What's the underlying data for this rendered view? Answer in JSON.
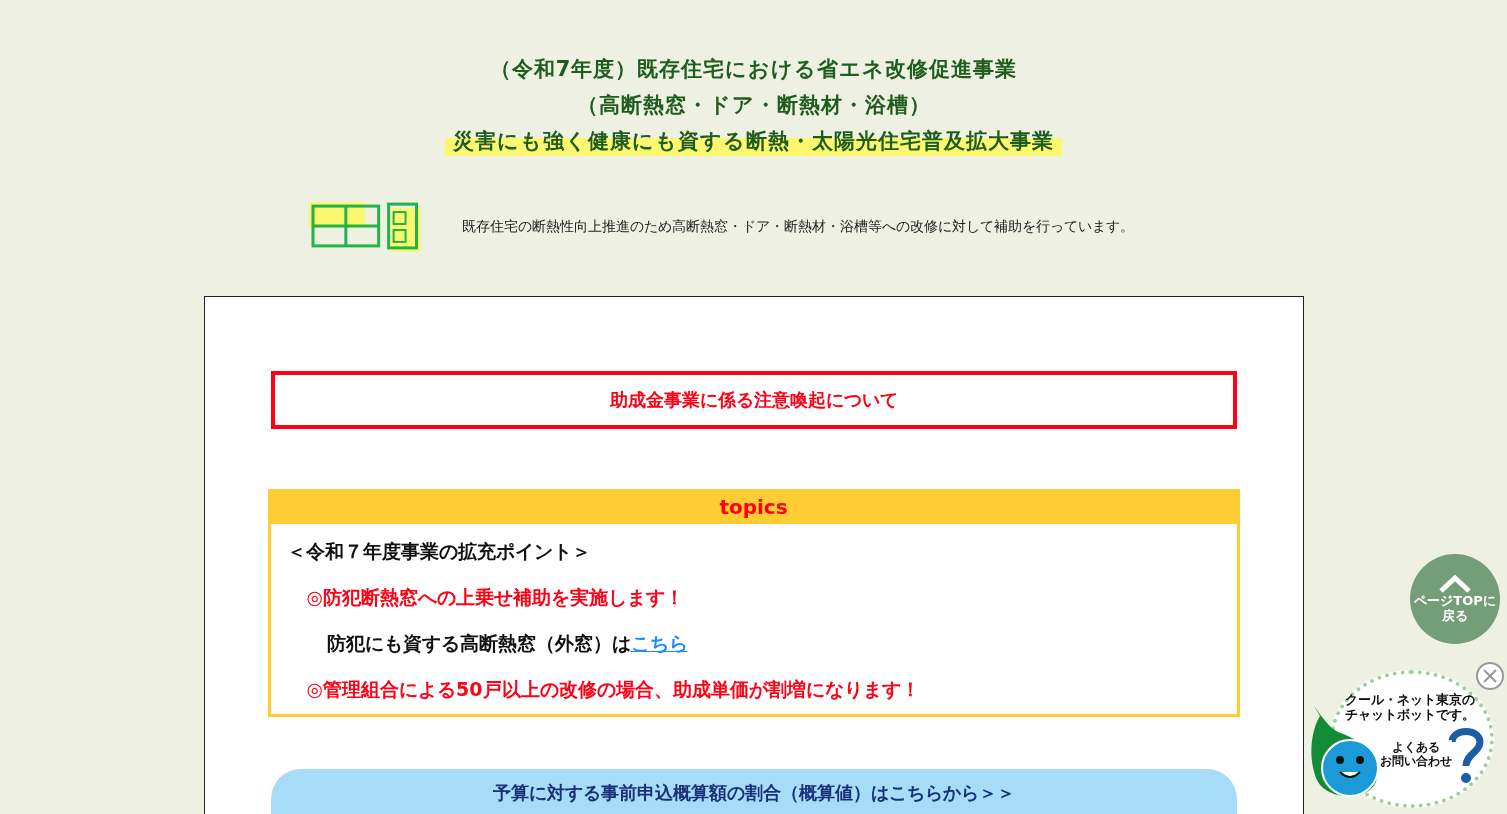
{
  "header": {
    "title_lines": [
      "（令和7年度）既存住宅における省エネ改修促進事業",
      "（高断熱窓・ドア・断熱材・浴槽）"
    ],
    "highlight_line": "災害にも強く健康にも資する断熱・太陽光住宅普及拡大事業",
    "description": "既存住宅の断熱性向上推進のため高断熱窓・ドア・断熱材・浴槽等への改修に対して補助を行っています。"
  },
  "notice_button": "助成金事業に係る注意喚起について",
  "topics": {
    "title": "topics",
    "items": [
      {
        "kind": "heading",
        "text": "＜令和７年度事業の拡充ポイント＞"
      },
      {
        "kind": "notice",
        "text": "◎防犯断熱窓への上乗せ補助を実施します！"
      },
      {
        "kind": "link-line",
        "text": "防犯にも資する高断熱窓（外窓）は",
        "link": "こちら"
      },
      {
        "kind": "notice",
        "text": "◎管理組合による50戸以上の改修の場合、助成単価が割増になります！"
      }
    ]
  },
  "budget_button": "予算に対する事前申込概算額の割合（概算値）はこちらから＞＞",
  "page_top": {
    "lines": [
      "ページTOPに",
      "戻る"
    ]
  },
  "chatbot": {
    "bubble_lines": [
      "クール・ネット東京の",
      "チャットボットです。"
    ],
    "faq_lines": [
      "よくある",
      "お問い合わせ"
    ]
  }
}
